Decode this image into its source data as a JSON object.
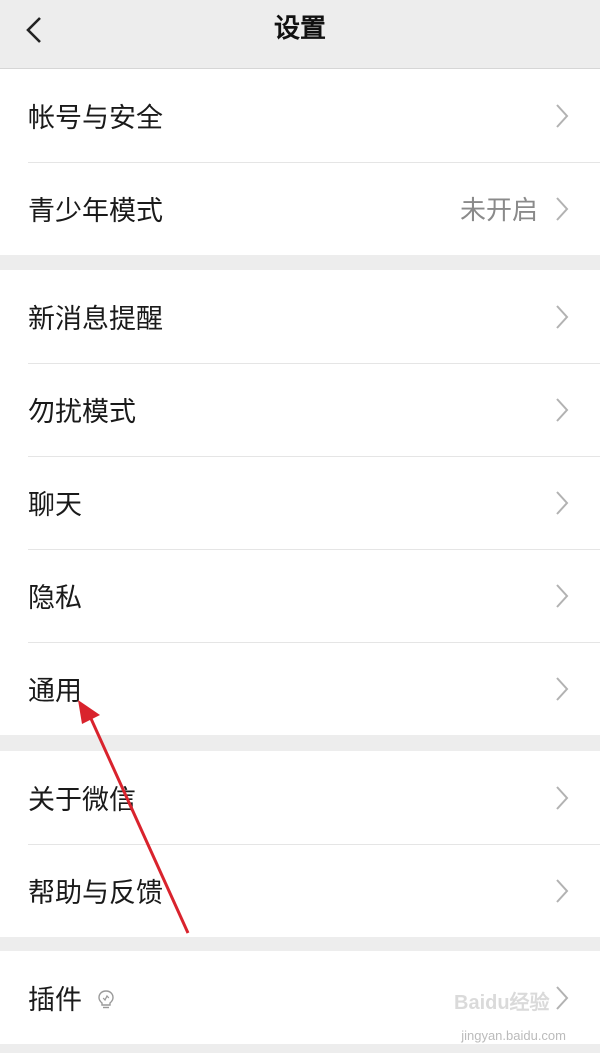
{
  "header": {
    "title": "设置",
    "back_icon": "chevron-left-icon"
  },
  "groups": [
    {
      "items": [
        {
          "label": "帐号与安全"
        },
        {
          "label": "青少年模式",
          "value": "未开启"
        }
      ]
    },
    {
      "items": [
        {
          "label": "新消息提醒"
        },
        {
          "label": "勿扰模式"
        },
        {
          "label": "聊天"
        },
        {
          "label": "隐私"
        },
        {
          "label": "通用"
        }
      ]
    },
    {
      "items": [
        {
          "label": "关于微信"
        },
        {
          "label": "帮助与反馈"
        }
      ]
    },
    {
      "items": [
        {
          "label": "插件",
          "icon": "lightbulb-icon"
        }
      ]
    }
  ],
  "annotation": {
    "color": "#d9232d",
    "points_to": "通用"
  },
  "watermark": {
    "text": "Baidu经验",
    "subtext": "jingyan.baidu.com"
  },
  "colors": {
    "page_bg": "#ededed",
    "cell_bg": "#ffffff",
    "chevron": "#b2b2b2"
  }
}
